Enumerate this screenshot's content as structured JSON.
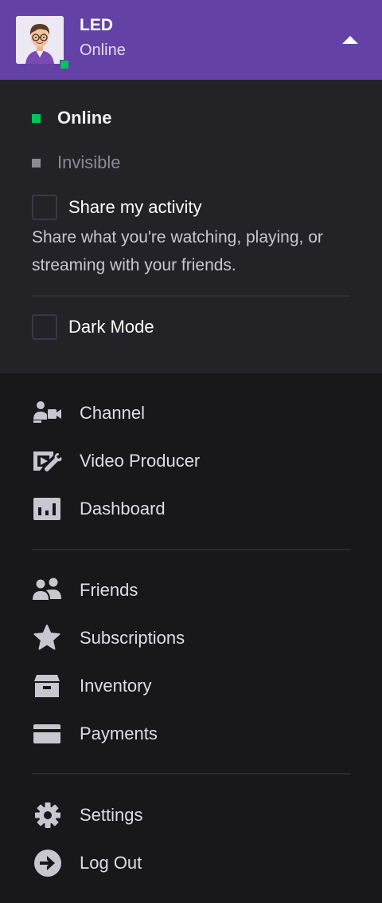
{
  "header": {
    "display_name": "LED",
    "status": "Online"
  },
  "status_panel": {
    "online_label": "Online",
    "invisible_label": "Invisible",
    "share_activity_label": "Share my activity",
    "share_activity_description": "Share what you're watching, playing, or streaming with your friends.",
    "dark_mode_label": "Dark Mode",
    "share_activity_checked": false,
    "dark_mode_checked": false
  },
  "nav": {
    "group1": [
      {
        "label": "Channel",
        "icon": "channel-camera-icon"
      },
      {
        "label": "Video Producer",
        "icon": "video-producer-icon"
      },
      {
        "label": "Dashboard",
        "icon": "dashboard-icon"
      }
    ],
    "group2": [
      {
        "label": "Friends",
        "icon": "friends-icon"
      },
      {
        "label": "Subscriptions",
        "icon": "star-icon"
      },
      {
        "label": "Inventory",
        "icon": "inventory-box-icon"
      },
      {
        "label": "Payments",
        "icon": "payment-card-icon"
      }
    ],
    "group3": [
      {
        "label": "Settings",
        "icon": "gear-icon"
      },
      {
        "label": "Log Out",
        "icon": "logout-icon"
      }
    ]
  },
  "colors": {
    "header_bg": "#6441a5",
    "online_green": "#00c35a",
    "panel_bg": "#232327",
    "menu_bg": "#18181b",
    "icon_color": "#c8c7d0"
  }
}
